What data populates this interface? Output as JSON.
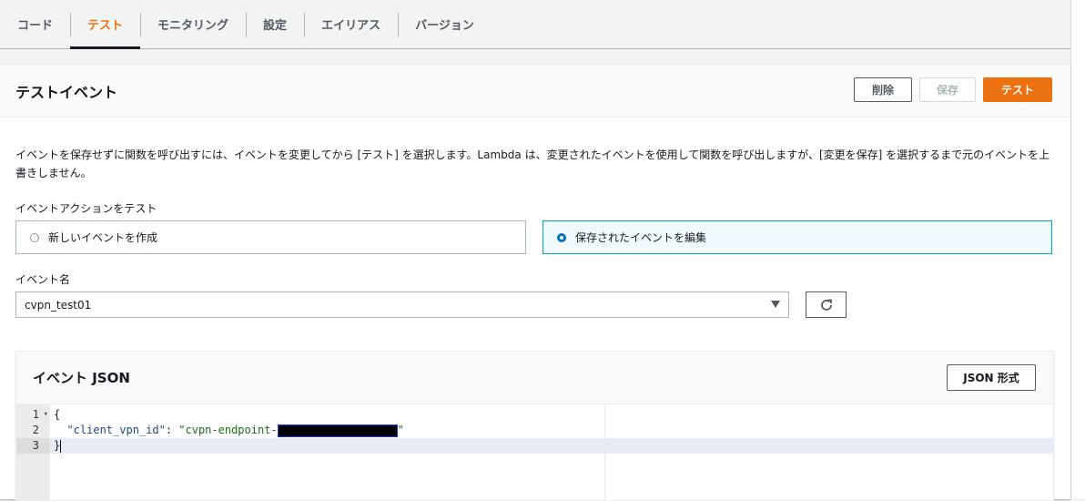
{
  "tabs": [
    {
      "label": "コード"
    },
    {
      "label": "テスト"
    },
    {
      "label": "モニタリング"
    },
    {
      "label": "設定"
    },
    {
      "label": "エイリアス"
    },
    {
      "label": "バージョン"
    }
  ],
  "active_tab": "テスト",
  "header": {
    "title": "テストイベント",
    "delete_label": "削除",
    "save_label": "保存",
    "test_label": "テスト"
  },
  "description": "イベントを保存せずに関数を呼び出すには、イベントを変更してから [テスト] を選択します。Lambda は、変更されたイベントを使用して関数を呼び出しますが、[変更を保存] を選択するまで元のイベントを上書きしません。",
  "event_action": {
    "label": "イベントアクションをテスト",
    "option_new": "新しいイベントを作成",
    "option_edit": "保存されたイベントを編集",
    "selected": "保存されたイベントを編集"
  },
  "event_name": {
    "label": "イベント名",
    "value": "cvpn_test01"
  },
  "json_panel": {
    "title": "イベント JSON",
    "format_label": "JSON 形式"
  },
  "editor": {
    "line_numbers": [
      "1",
      "2",
      "3"
    ],
    "line1": "{",
    "line2_key": "\"client_vpn_id\"",
    "line2_sep": ": ",
    "line2_value_prefix": "\"cvpn-endpoint-",
    "line2_value_suffix": "\"",
    "line3": "}"
  },
  "colors": {
    "accent": "#ec7211",
    "selected_tile_border": "#00a1c9",
    "radio_selected": "#0073bb"
  }
}
